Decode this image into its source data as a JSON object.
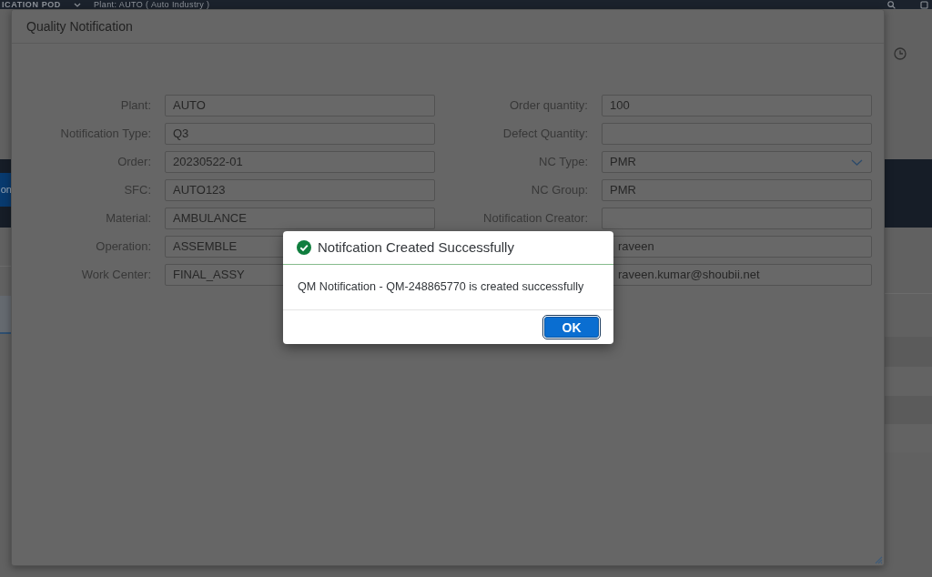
{
  "app_header": {
    "title": "ICATION POD",
    "plant": "Plant: AUTO ( Auto Industry )"
  },
  "side_button": {
    "label": "on"
  },
  "dialog": {
    "title": "Quality Notification",
    "left_fields": [
      {
        "label": "Plant:",
        "value": "AUTO",
        "kind": "text"
      },
      {
        "label": "Notification Type:",
        "value": "Q3",
        "kind": "text"
      },
      {
        "label": "Order:",
        "value": "20230522-01",
        "kind": "text"
      },
      {
        "label": "SFC:",
        "value": "AUTO123",
        "kind": "text"
      },
      {
        "label": "Material:",
        "value": "AMBULANCE",
        "kind": "text"
      },
      {
        "label": "Operation:",
        "value": "ASSEMBLE",
        "kind": "text"
      },
      {
        "label": "Work Center:",
        "value": "FINAL_ASSY",
        "kind": "text"
      }
    ],
    "right_fields": [
      {
        "label": "Order quantity:",
        "value": "100",
        "kind": "text"
      },
      {
        "label": "Defect Quantity:",
        "kind": "text"
      },
      {
        "label": "NC Type:",
        "value": "PMR",
        "kind": "select"
      },
      {
        "label": "NC Group:",
        "value": "PMR",
        "kind": "text"
      },
      {
        "label": "Notification Creator:",
        "kind": "text"
      },
      {
        "value": "raveen",
        "kind": "text"
      },
      {
        "value": "raveen.kumar@shoubii.net",
        "kind": "text"
      }
    ]
  },
  "message_box": {
    "title": "Notifcation Created Successfully",
    "text": "QM Notification - QM-248865770 is created successfully",
    "buttons": [
      {
        "label": "OK",
        "emphasized": true
      }
    ]
  }
}
